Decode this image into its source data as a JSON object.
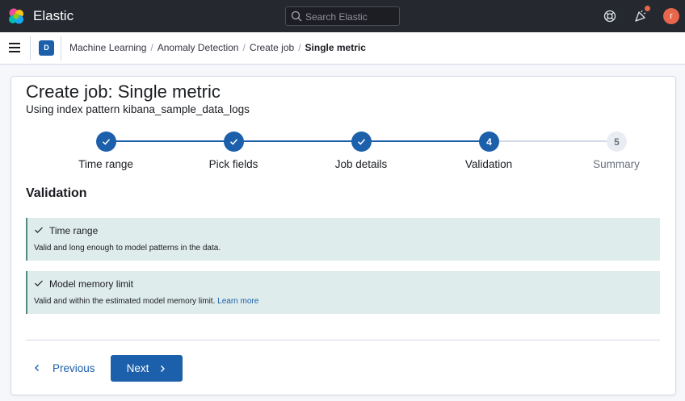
{
  "header": {
    "brand": "Elastic",
    "search_placeholder": "Search Elastic",
    "avatar_initial": "r"
  },
  "breadcrumbs": {
    "space_initial": "D",
    "items": [
      "Machine Learning",
      "Anomaly Detection",
      "Create job",
      "Single metric"
    ]
  },
  "page": {
    "title": "Create job: Single metric",
    "subtitle": "Using index pattern kibana_sample_data_logs"
  },
  "steps": [
    {
      "label": "Time range",
      "status": "complete"
    },
    {
      "label": "Pick fields",
      "status": "complete"
    },
    {
      "label": "Job details",
      "status": "complete"
    },
    {
      "label": "Validation",
      "status": "current",
      "number": "4"
    },
    {
      "label": "Summary",
      "status": "incomplete",
      "number": "5"
    }
  ],
  "validation": {
    "heading": "Validation",
    "callouts": [
      {
        "title": "Time range",
        "body": "Valid and long enough to model patterns in the data.",
        "link": ""
      },
      {
        "title": "Model memory limit",
        "body": "Valid and within the estimated model memory limit.",
        "link": "Learn more"
      }
    ]
  },
  "footer": {
    "previous_label": "Previous",
    "next_label": "Next"
  },
  "colors": {
    "accent": "#1c5faa",
    "success_bg": "#dfecec",
    "header_bg": "#25282f"
  }
}
